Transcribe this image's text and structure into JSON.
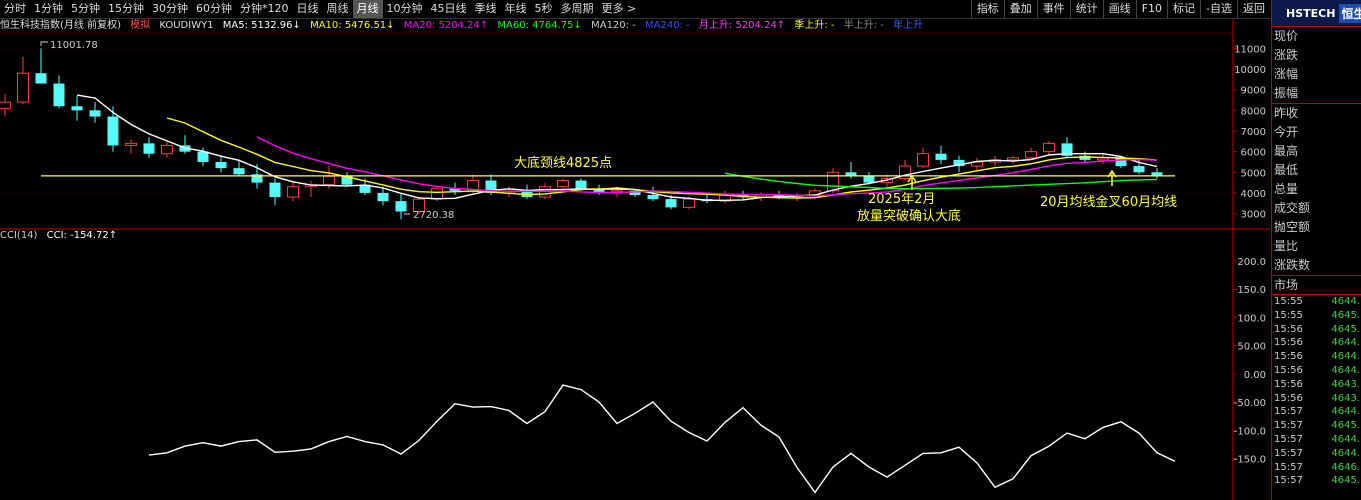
{
  "toolbar": {
    "periods": [
      "分时",
      "1分钟",
      "5分钟",
      "15分钟",
      "30分钟",
      "60分钟",
      "分钟*120",
      "日线",
      "周线",
      "月线",
      "10分钟",
      "45日线",
      "季线",
      "年线",
      "5秒",
      "多周期",
      "更多 >"
    ],
    "active_period": "月线",
    "tools": [
      "指标",
      "叠加",
      "事件",
      "统计",
      "画线",
      "F10",
      "标记",
      "-自选",
      "返回"
    ]
  },
  "info": {
    "title": "恒生科技指数(月线 前复权)",
    "mode": "模拟",
    "indicator": "KOUDIWY1",
    "ma5": "MA5: 5132.96↓",
    "ma10": "MA10: 5476.51↓",
    "ma20": "MA20: 5204.24↑",
    "ma60": "MA60: 4764.75↓",
    "ma120": "MA120: -",
    "ma240": "MA240: -",
    "yue": "月上升: 5204.24↑",
    "ji": "季上升: -",
    "ban": "半上升: -",
    "nian": "年上升"
  },
  "cci": {
    "label": "CCI(14)",
    "value": "CCI: -154.72↑"
  },
  "annotations": {
    "neckline": "大底颈线4825点",
    "feb2025_line1": "2025年2月",
    "feb2025_line2": "放量突破确认大底",
    "golden_cross": "20月均线金叉60月均线",
    "high_label": "11001.78",
    "low_label": "2720.38"
  },
  "right_panel": {
    "code": "HSTECH",
    "name": "恒生科",
    "fields": [
      "现价",
      "涨跌",
      "涨幅",
      "振幅"
    ],
    "fields2": [
      "昨收",
      "今开",
      "最高",
      "最低",
      "总量",
      "成交额",
      "抛空额",
      "量比",
      "涨跌数"
    ],
    "market": "市场",
    "ticks": [
      {
        "t": "15:55",
        "p": "4644."
      },
      {
        "t": "15:55",
        "p": "4645."
      },
      {
        "t": "15:56",
        "p": "4645."
      },
      {
        "t": "15:56",
        "p": "4644."
      },
      {
        "t": "15:56",
        "p": "4644."
      },
      {
        "t": "15:56",
        "p": "4644."
      },
      {
        "t": "15:56",
        "p": "4643."
      },
      {
        "t": "15:56",
        "p": "4643."
      },
      {
        "t": "15:57",
        "p": "4644."
      },
      {
        "t": "15:57",
        "p": "4645."
      },
      {
        "t": "15:57",
        "p": "4644."
      },
      {
        "t": "15:57",
        "p": "4644."
      },
      {
        "t": "15:57",
        "p": "4646."
      },
      {
        "t": "15:57",
        "p": "4645."
      }
    ]
  },
  "chart_data": {
    "type": "candlestick",
    "price_axis": {
      "ticks": [
        3000,
        4000,
        5000,
        6000,
        7000,
        8000,
        9000,
        10000,
        11000
      ],
      "range": [
        2300,
        11700
      ]
    },
    "cci_axis": {
      "ticks": [
        200.0,
        150.0,
        100.0,
        50.0,
        0.0,
        -50.0,
        -100.0,
        -150.0
      ],
      "range": [
        -220,
        230
      ]
    },
    "neckline": 4825,
    "colors": {
      "up": "#ff3b3b",
      "down": "#54fcfc",
      "ma5": "#ffffff",
      "ma10": "#ffff00",
      "ma20": "#ff00ff",
      "ma60": "#00ff00",
      "neck": "#ffff66",
      "cci": "#ffffff"
    },
    "candles": [
      [
        8100,
        8800,
        7700,
        8400
      ],
      [
        8400,
        10600,
        8300,
        9800
      ],
      [
        9800,
        11001.78,
        9500,
        9300
      ],
      [
        9300,
        9700,
        8100,
        8200
      ],
      [
        8200,
        8700,
        7500,
        8000
      ],
      [
        8000,
        8400,
        7400,
        7700
      ],
      [
        7700,
        8200,
        6000,
        6300
      ],
      [
        6300,
        6600,
        5900,
        6400
      ],
      [
        6400,
        6700,
        5700,
        5900
      ],
      [
        5900,
        6500,
        5700,
        6300
      ],
      [
        6300,
        6800,
        5900,
        6000
      ],
      [
        6000,
        6200,
        5300,
        5500
      ],
      [
        5500,
        5800,
        5000,
        5200
      ],
      [
        5200,
        5600,
        4800,
        4900
      ],
      [
        4900,
        5400,
        4200,
        4500
      ],
      [
        4500,
        4700,
        3400,
        3800
      ],
      [
        3800,
        4600,
        3600,
        4300
      ],
      [
        4300,
        4600,
        3800,
        4400
      ],
      [
        4400,
        5300,
        4200,
        4800
      ],
      [
        4800,
        5000,
        4300,
        4400
      ],
      [
        4400,
        4700,
        3900,
        4000
      ],
      [
        4000,
        4300,
        3400,
        3600
      ],
      [
        3600,
        4000,
        2720.38,
        3100
      ],
      [
        3100,
        3800,
        3000,
        3700
      ],
      [
        3700,
        4300,
        3600,
        4200
      ],
      [
        4200,
        4500,
        3900,
        4100
      ],
      [
        4100,
        4900,
        4000,
        4600
      ],
      [
        4600,
        4900,
        3900,
        4000
      ],
      [
        4000,
        4300,
        3800,
        4100
      ],
      [
        4100,
        4400,
        3700,
        3800
      ],
      [
        3800,
        4500,
        3700,
        4300
      ],
      [
        4300,
        4700,
        4200,
        4600
      ],
      [
        4600,
        4700,
        4100,
        4200
      ],
      [
        4200,
        4400,
        3900,
        4000
      ],
      [
        4000,
        4300,
        3800,
        4100
      ],
      [
        4100,
        4200,
        3800,
        3900
      ],
      [
        3900,
        4300,
        3600,
        3700
      ],
      [
        3700,
        3900,
        3200,
        3300
      ],
      [
        3300,
        3800,
        3200,
        3700
      ],
      [
        3700,
        3900,
        3500,
        3600
      ],
      [
        3600,
        4100,
        3500,
        3900
      ],
      [
        3900,
        4100,
        3700,
        3800
      ],
      [
        3800,
        4000,
        3600,
        3900
      ],
      [
        3900,
        4100,
        3700,
        3800
      ],
      [
        3800,
        4000,
        3600,
        3900
      ],
      [
        3900,
        4200,
        3700,
        4100
      ],
      [
        4100,
        5200,
        4000,
        5000
      ],
      [
        5000,
        5500,
        4700,
        4800
      ],
      [
        4800,
        5000,
        4400,
        4500
      ],
      [
        4500,
        4900,
        4300,
        4700
      ],
      [
        4700,
        5600,
        4600,
        5300
      ],
      [
        5300,
        6200,
        5200,
        5900
      ],
      [
        5900,
        6300,
        5400,
        5600
      ],
      [
        5600,
        5800,
        5000,
        5300
      ],
      [
        5300,
        5700,
        5100,
        5500
      ],
      [
        5500,
        5800,
        5300,
        5600
      ],
      [
        5600,
        5800,
        5400,
        5700
      ],
      [
        5700,
        6200,
        5600,
        6000
      ],
      [
        6000,
        6500,
        5800,
        6400
      ],
      [
        6400,
        6700,
        5700,
        5800
      ],
      [
        5800,
        6000,
        5500,
        5600
      ],
      [
        5600,
        5900,
        5400,
        5700
      ],
      [
        5700,
        5800,
        5200,
        5300
      ],
      [
        5300,
        5600,
        4900,
        5000
      ],
      [
        5000,
        5200,
        4700,
        4800
      ]
    ],
    "cci_values": [
      null,
      null,
      null,
      null,
      null,
      null,
      null,
      null,
      -144,
      -140,
      -128,
      -122,
      -128,
      -120,
      -117,
      -139,
      -137,
      -133,
      -120,
      -111,
      -120,
      -126,
      -142,
      -118,
      -84,
      -53,
      -59,
      -58,
      -65,
      -88,
      -67,
      -20,
      -28,
      -50,
      -88,
      -70,
      -50,
      -84,
      -104,
      -119,
      -86,
      -60,
      -91,
      -112,
      -166,
      -210,
      -165,
      -141,
      -165,
      -183,
      -162,
      -141,
      -140,
      -130,
      -158,
      -201,
      -186,
      -145,
      -128,
      -105,
      -115,
      -95,
      -85,
      -105,
      -140,
      -154.72
    ]
  }
}
